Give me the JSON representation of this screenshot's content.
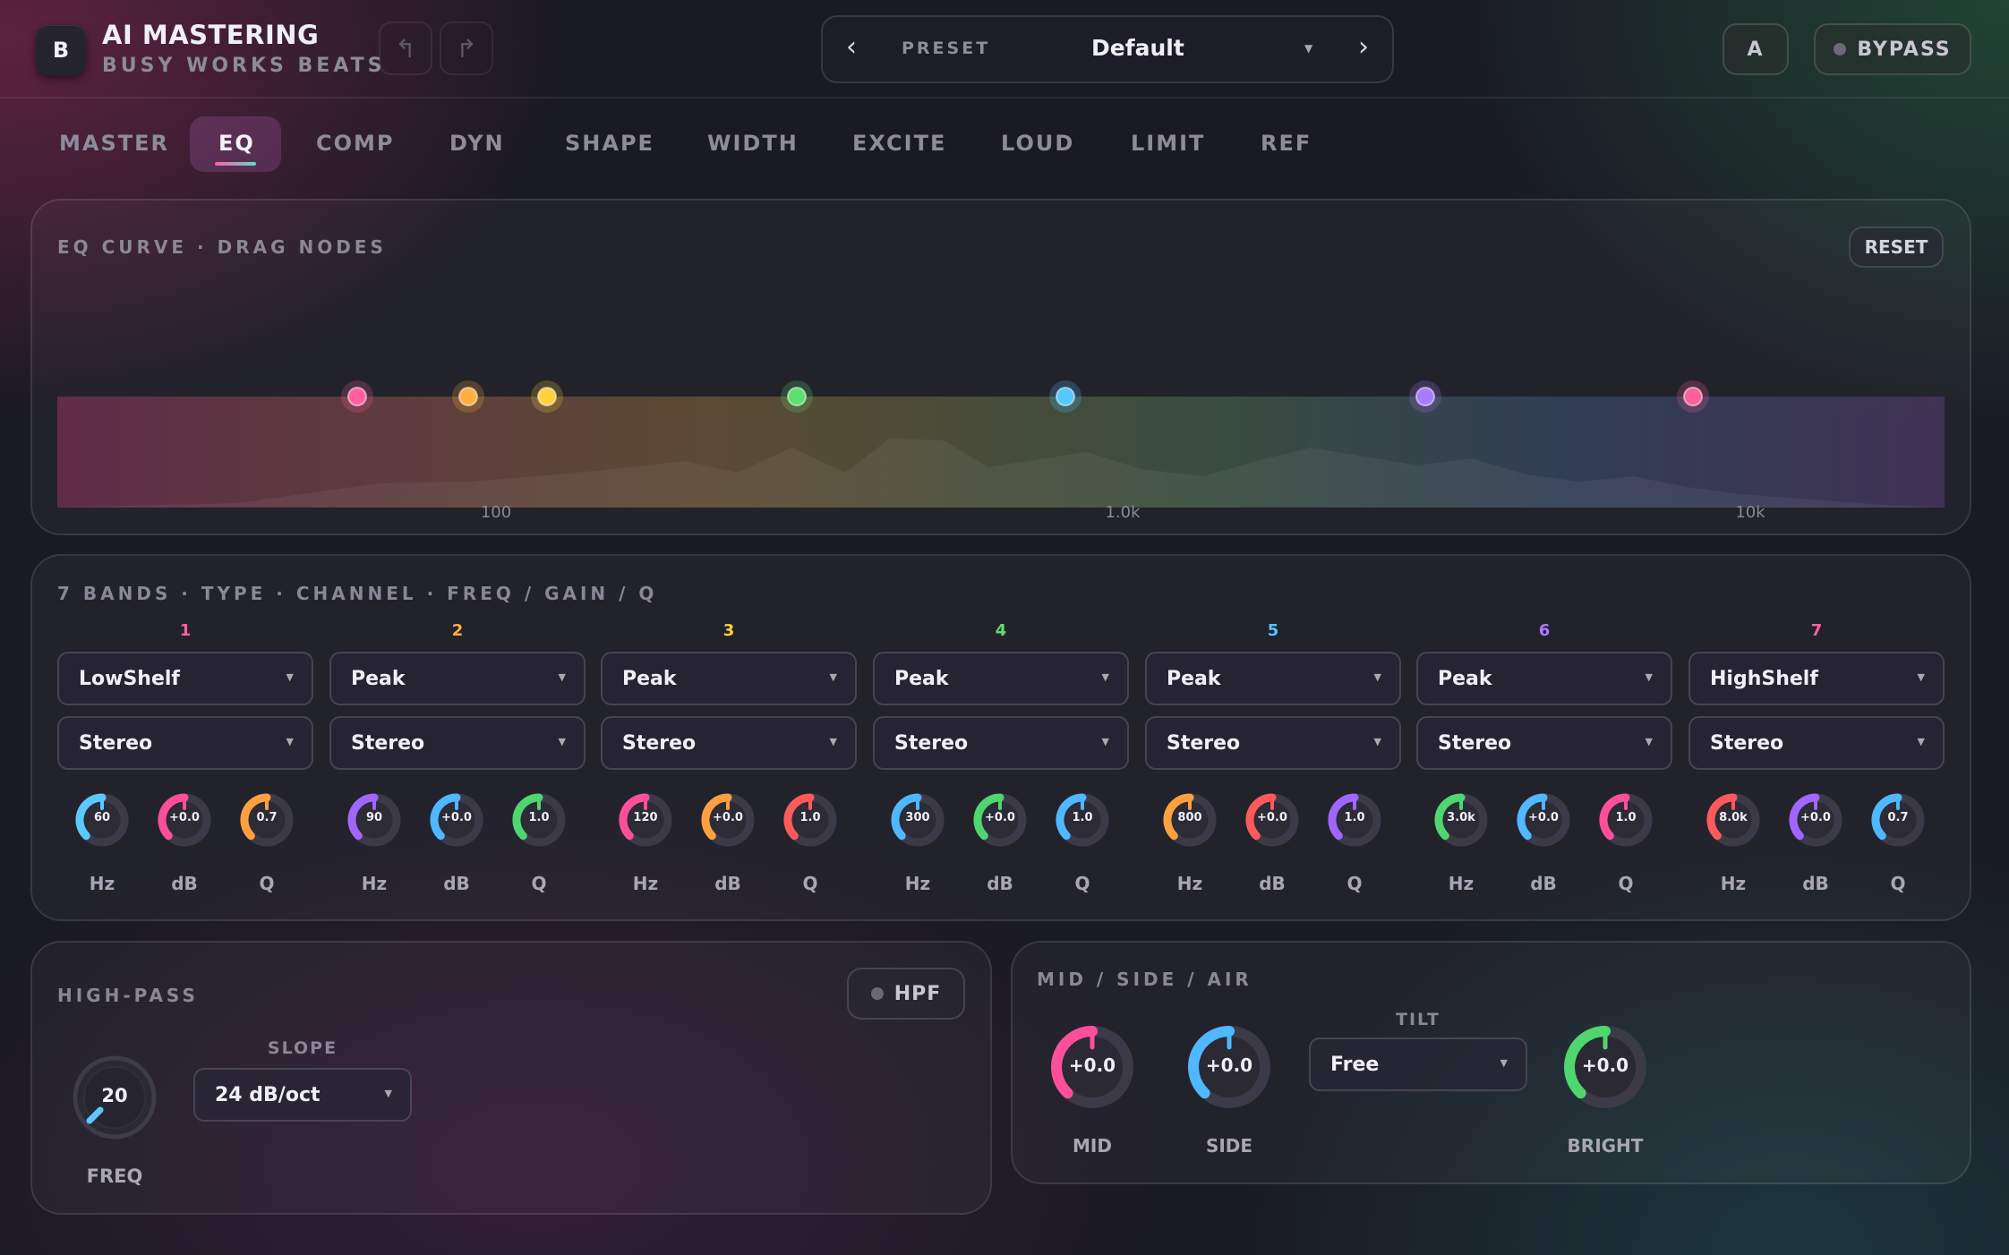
{
  "header": {
    "logo": "B",
    "title": "AI MASTERING",
    "subtitle": "BUSY WORKS BEATS",
    "undo_icon": "undo-icon",
    "redo_icon": "redo-icon"
  },
  "preset": {
    "label": "PRESET",
    "value": "Default",
    "prev": "‹",
    "next": "›"
  },
  "ab_button": "A",
  "bypass_button": "BYPASS",
  "tabs": [
    "MASTER",
    "EQ",
    "COMP",
    "DYN",
    "SHAPE",
    "WIDTH",
    "EXCITE",
    "LOUD",
    "LIMIT",
    "REF"
  ],
  "active_tab": "EQ",
  "curve": {
    "title": "EQ CURVE · DRAG NODES",
    "reset": "RESET",
    "axis": [
      "100",
      "1.0k",
      "10k"
    ],
    "gain_db": [
      0,
      0,
      0,
      0,
      0,
      0,
      0
    ]
  },
  "bands_panel": {
    "title": "7 BANDS · TYPE · CHANNEL · FREQ / GAIN / Q",
    "knob_labels": [
      "Hz",
      "dB",
      "Q"
    ],
    "bands": [
      {
        "num": "1",
        "color": "#ff5fa0",
        "type": "LowShelf",
        "channel": "Stereo",
        "freq": "60",
        "gain": "+0.0",
        "q": "0.7",
        "k": [
          "#5cc8ff",
          "#ff4f9a",
          "#ffa040"
        ]
      },
      {
        "num": "2",
        "color": "#ffb040",
        "type": "Peak",
        "channel": "Stereo",
        "freq": "90",
        "gain": "+0.0",
        "q": "1.0",
        "k": [
          "#a066ff",
          "#4fb8ff",
          "#4fd66e"
        ]
      },
      {
        "num": "3",
        "color": "#ffd23c",
        "type": "Peak",
        "channel": "Stereo",
        "freq": "120",
        "gain": "+0.0",
        "q": "1.0",
        "k": [
          "#ff4f9a",
          "#ffa040",
          "#ff5a5a"
        ]
      },
      {
        "num": "4",
        "color": "#5fe06e",
        "type": "Peak",
        "channel": "Stereo",
        "freq": "300",
        "gain": "+0.0",
        "q": "1.0",
        "k": [
          "#4fb8ff",
          "#4fd66e",
          "#4fb8ff"
        ]
      },
      {
        "num": "5",
        "color": "#54c8ff",
        "type": "Peak",
        "channel": "Stereo",
        "freq": "800",
        "gain": "+0.0",
        "q": "1.0",
        "k": [
          "#ffa040",
          "#ff5a5a",
          "#a066ff"
        ]
      },
      {
        "num": "6",
        "color": "#a77dff",
        "type": "Peak",
        "channel": "Stereo",
        "freq": "3.0k",
        "gain": "+0.0",
        "q": "1.0",
        "k": [
          "#4fd66e",
          "#4fb8ff",
          "#ff4f9a"
        ]
      },
      {
        "num": "7",
        "color": "#ff5f9a",
        "type": "HighShelf",
        "channel": "Stereo",
        "freq": "8.0k",
        "gain": "+0.0",
        "q": "0.7",
        "k": [
          "#ff5a5a",
          "#a066ff",
          "#4fb8ff"
        ]
      }
    ]
  },
  "highpass": {
    "title": "HIGH-PASS",
    "hpf_button": "HPF",
    "freq_value": "20",
    "freq_label": "FREQ",
    "slope_label": "SLOPE",
    "slope_value": "24 dB/oct"
  },
  "midside": {
    "title": "MID / SIDE / AIR",
    "mid_value": "+0.0",
    "mid_label": "MID",
    "side_value": "+0.0",
    "side_label": "SIDE",
    "tilt_label": "TILT",
    "tilt_value": "Free",
    "bright_value": "+0.0",
    "bright_label": "BRIGHT"
  }
}
